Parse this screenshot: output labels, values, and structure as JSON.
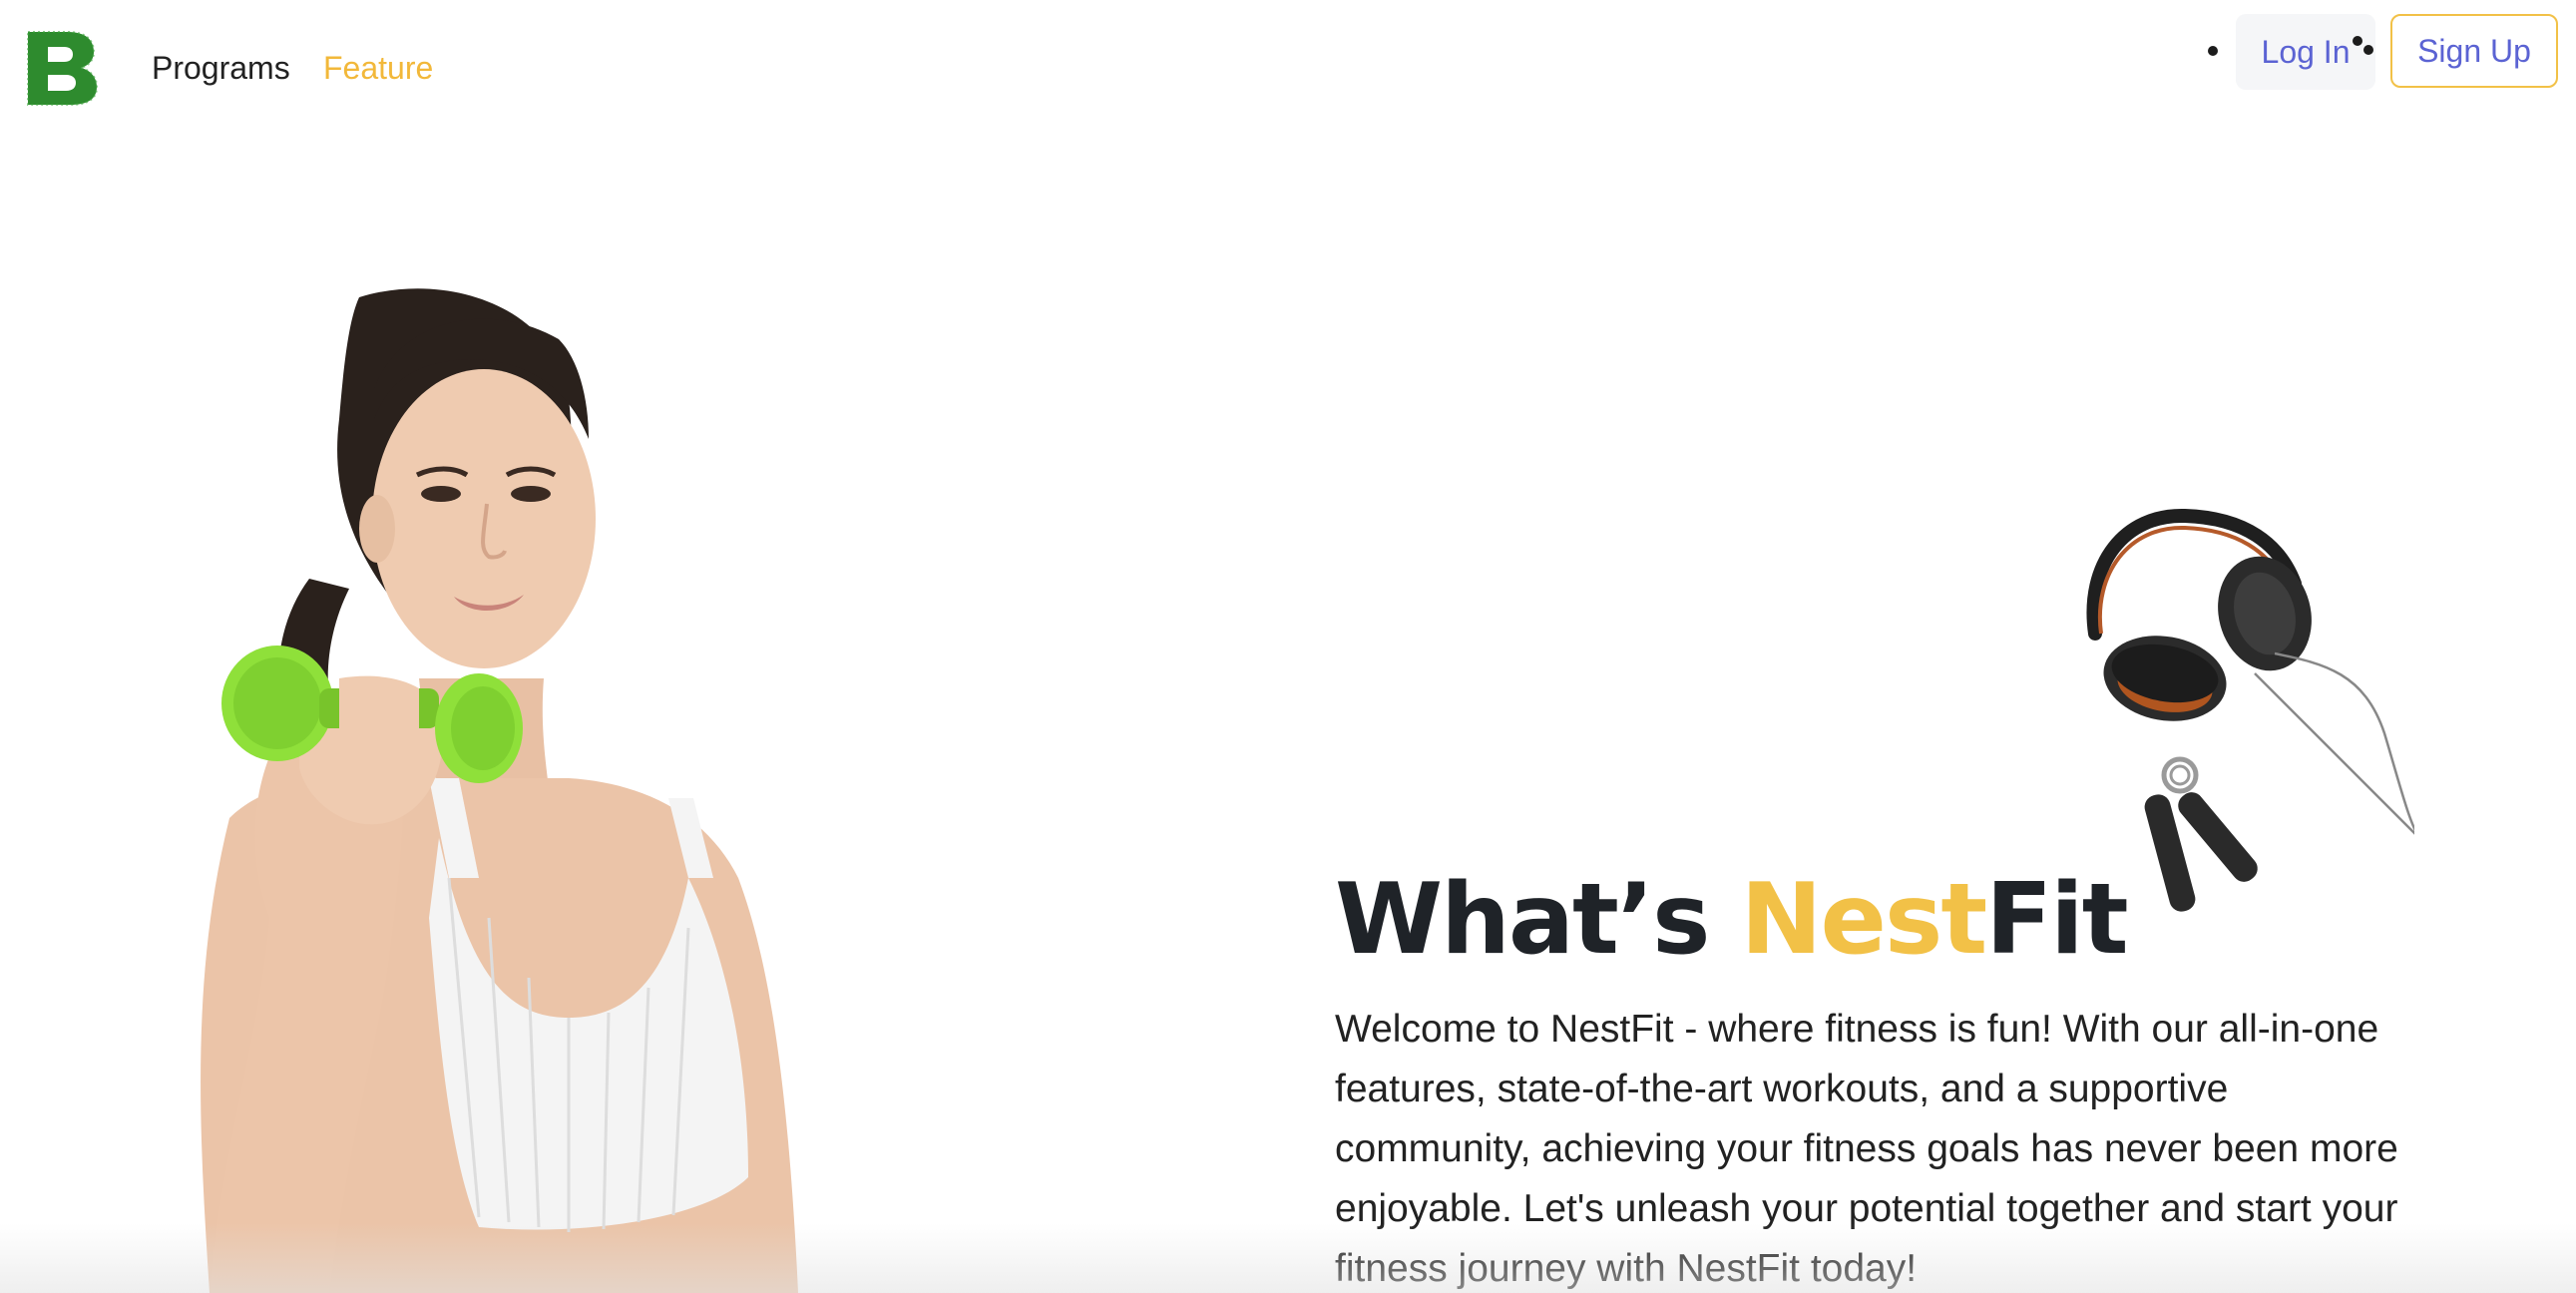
{
  "header": {
    "logo_letter": "B",
    "logo_icon": "brand-logo-icon",
    "nav": [
      {
        "label": "Programs",
        "active": false
      },
      {
        "label": "Feature",
        "active": true
      }
    ],
    "login_label": "Log In",
    "signup_label": "Sign Up"
  },
  "hero": {
    "title_prefix": "What’s ",
    "title_accent": "Nest",
    "title_suffix": "Fit",
    "description": "Welcome to NestFit - where fitness is fun! With our all-in-one features, state-of-the-art workouts, and a supportive community, achieving your fitness goals has never been more enjoyable. Let's unleash your potential together and start your fitness journey with NestFit today!",
    "images": {
      "woman": "woman-with-dumbbell-image",
      "equipment": "headphones-and-hand-grip-image"
    }
  },
  "colors": {
    "accent_yellow": "#f2c147",
    "link_blue": "#5b63d3",
    "logo_green": "#2e8b2e",
    "dumbbell_green": "#8fe03a",
    "text_dark": "#1f2328"
  }
}
